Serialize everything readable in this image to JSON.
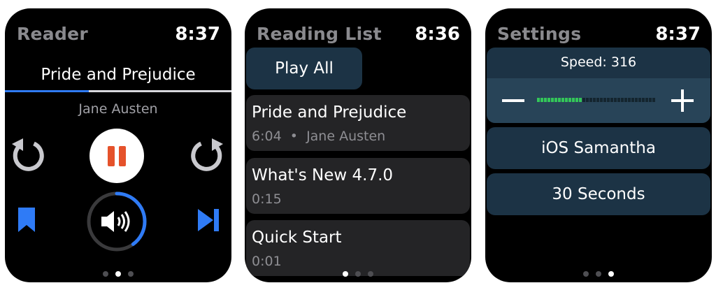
{
  "reader": {
    "title": "Reader",
    "time": "8:37",
    "book_title": "Pride and Prejudice",
    "author": "Jane Austen",
    "progress": 0.37,
    "volume_level": 0.4,
    "page_index": 1
  },
  "reading_list": {
    "title": "Reading List",
    "time": "8:36",
    "play_all_label": "Play All",
    "items": [
      {
        "title": "Pride and Prejudice",
        "duration": "6:04",
        "author": "Jane Austen"
      },
      {
        "title": "What's New 4.7.0",
        "duration": "0:15"
      },
      {
        "title": "Quick Start",
        "duration": "0:01"
      }
    ]
  },
  "settings": {
    "title": "Settings",
    "time": "8:37",
    "speed_label": "Speed: 316",
    "speed_level": 0.37,
    "voice": "iOS Samantha",
    "interval": "30 Seconds"
  },
  "colors": {
    "accent_blue": "#2f7bf6",
    "pause_orange": "#e5522b",
    "slider_green": "#33c659",
    "panel_blue": "#1c3345"
  },
  "icons": {
    "skip_back": "rewind-arrow-icon",
    "pause": "pause-icon",
    "skip_forward": "forward-arrow-icon",
    "bookmark": "bookmark-icon",
    "volume": "speaker-icon",
    "next": "next-track-icon",
    "minus": "minus-icon",
    "plus": "plus-icon"
  }
}
